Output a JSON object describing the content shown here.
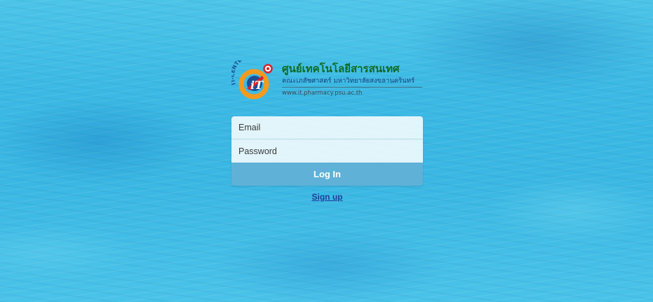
{
  "logo": {
    "badge_text": "IT-CENTER",
    "title_th": "ศูนย์เทคโนโลยีสารสนเทศ",
    "subtitle_th": "คณะเภสัชศาสตร์ มหาวิทยาลัยสงขลานครินทร์",
    "url": "www.it.pharmacy.psu.ac.th"
  },
  "login_form": {
    "email_placeholder": "Email",
    "email_value": "",
    "password_placeholder": "Password",
    "password_value": "",
    "login_label": "Log In"
  },
  "signup_label": "Sign up",
  "colors": {
    "background": "#3bb9e4",
    "login_button": "#5fb1d8",
    "logo_title": "#0f6a22",
    "signup_link": "#1f3f9a"
  }
}
